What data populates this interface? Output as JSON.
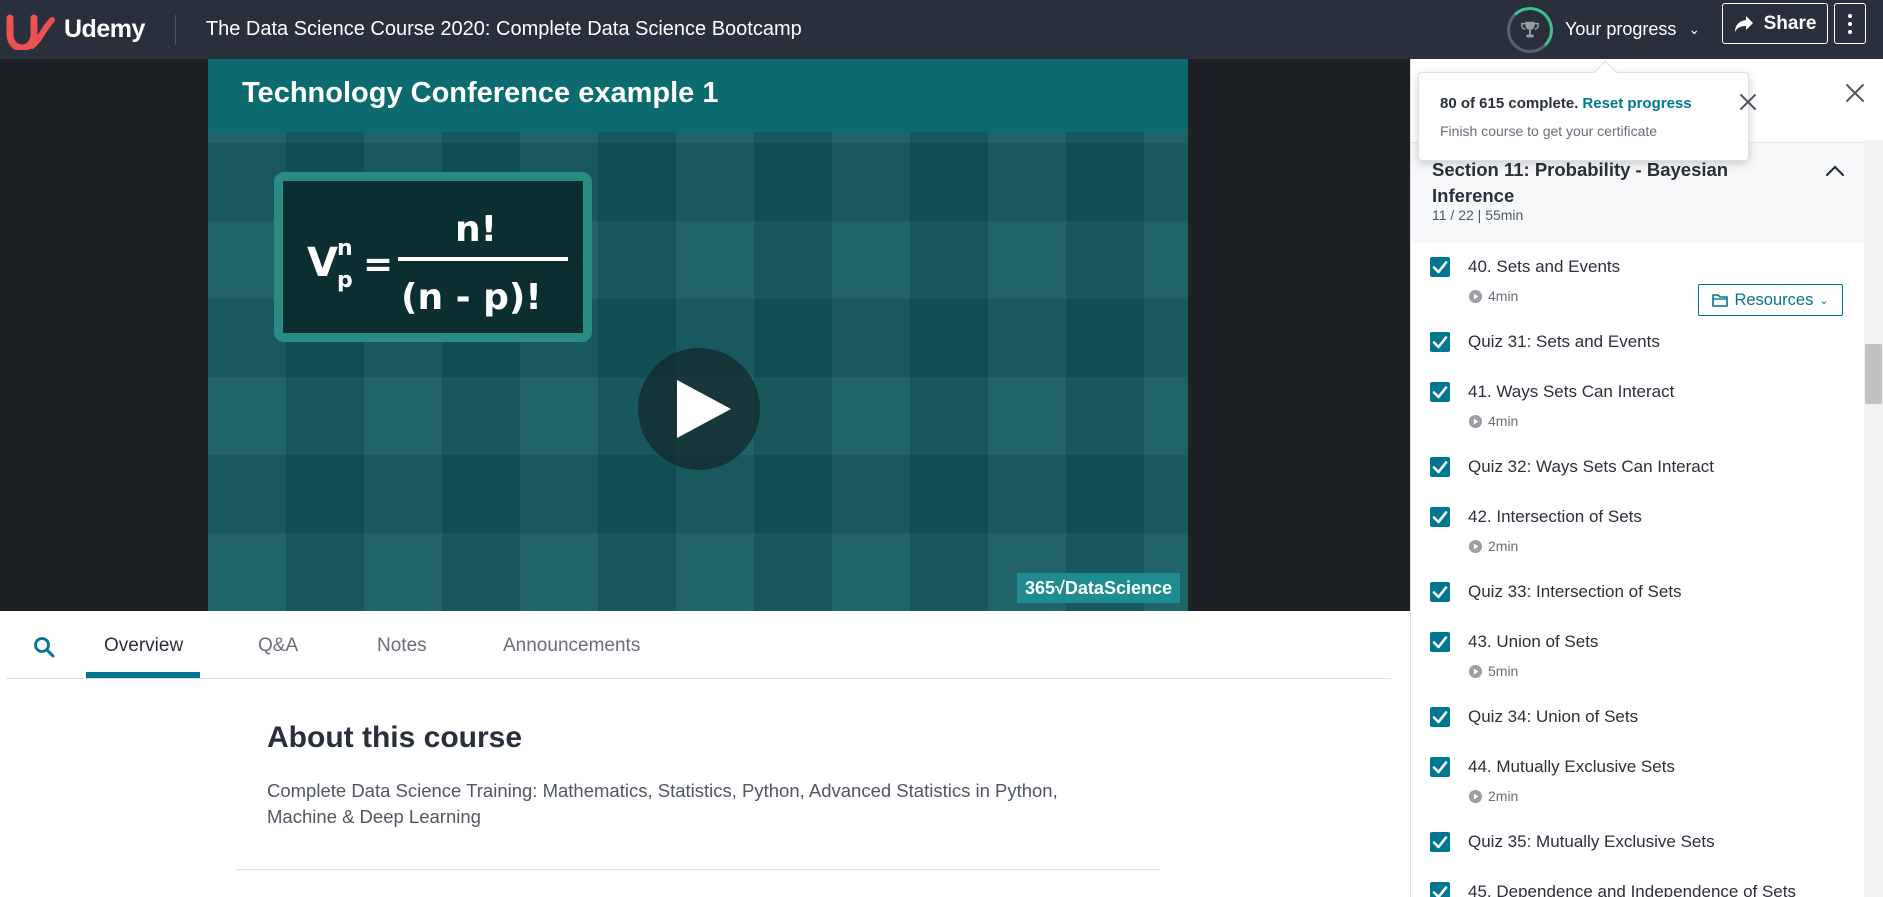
{
  "header": {
    "brand": "Udemy",
    "course_title": "The Data Science Course 2020: Complete Data Science Bootcamp",
    "progress_label": "Your progress",
    "share_label": "Share"
  },
  "video": {
    "slide_title": "Technology Conference example 1",
    "watermark": "365√DataScience"
  },
  "tabs": {
    "overview": "Overview",
    "qa": "Q&A",
    "notes": "Notes",
    "announcements": "Announcements",
    "active": "Overview"
  },
  "about": {
    "title": "About this course",
    "description": "Complete Data Science Training: Mathematics, Statistics, Python, Advanced Statistics in Python, Machine & Deep Learning"
  },
  "progress_popover": {
    "summary": "80 of 615 complete.",
    "reset": "Reset progress",
    "hint": "Finish course to get your certificate",
    "completed": 80,
    "total": 615
  },
  "sidebar": {
    "section": {
      "title": "Section 11: Probability - Bayesian Inference",
      "meta": "11 / 22 | 55min"
    },
    "resources_label": "Resources",
    "items": [
      {
        "title": "40. Sets and Events",
        "duration": "4min",
        "checked": true
      },
      {
        "title": "Quiz 31: Sets and Events",
        "duration": "",
        "checked": true
      },
      {
        "title": "41. Ways Sets Can Interact",
        "duration": "4min",
        "checked": true
      },
      {
        "title": "Quiz 32: Ways Sets Can Interact",
        "duration": "",
        "checked": true
      },
      {
        "title": "42. Intersection of Sets",
        "duration": "2min",
        "checked": true
      },
      {
        "title": "Quiz 33: Intersection of Sets",
        "duration": "",
        "checked": true
      },
      {
        "title": "43. Union of Sets",
        "duration": "5min",
        "checked": true
      },
      {
        "title": "Quiz 34: Union of Sets",
        "duration": "",
        "checked": true
      },
      {
        "title": "44. Mutually Exclusive Sets",
        "duration": "2min",
        "checked": true
      },
      {
        "title": "Quiz 35: Mutually Exclusive Sets",
        "duration": "",
        "checked": true
      },
      {
        "title": "45. Dependence and Independence of Sets",
        "duration": "",
        "checked": true
      }
    ]
  },
  "colors": {
    "header_bg": "#29303b",
    "accent": "#007791",
    "brand": "#ec5252"
  }
}
